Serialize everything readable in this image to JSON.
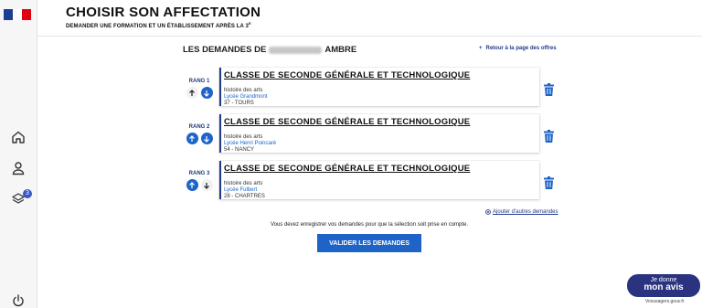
{
  "header": {
    "title": "CHOISIR SON AFFECTATION",
    "subtitle": "DEMANDER UNE FORMATION ET UN ÉTABLISSEMENT APRÈS LA 3",
    "subtitle_sup": "E"
  },
  "sidebar": {
    "items": [
      {
        "icon": "home-icon"
      },
      {
        "icon": "user-icon"
      },
      {
        "icon": "layers-icon",
        "badge": "3"
      },
      {
        "icon": "power-icon"
      }
    ]
  },
  "requests": {
    "heading_prefix": "LES DEMANDES DE",
    "heading_name": "AMBRE",
    "back_link": "Retour à la page des offres",
    "add_link": "Ajouter d'autres demandes",
    "items": [
      {
        "rank": "RANG 1",
        "title": "CLASSE DE SECONDE GÉNÉRALE ET TECHNOLOGIQUE",
        "option": "histoire des arts",
        "school": "Lycée Grandmont",
        "city": "37 - TOURS"
      },
      {
        "rank": "RANG 2",
        "title": "CLASSE DE SECONDE GÉNÉRALE ET TECHNOLOGIQUE",
        "option": "histoire des arts",
        "school": "Lycée Henri Poincaré",
        "city": "54 - NANCY"
      },
      {
        "rank": "RANG 3",
        "title": "CLASSE DE SECONDE GÉNÉRALE ET TECHNOLOGIQUE",
        "option": "histoire des arts",
        "school": "Lycée Fulbert",
        "city": "28 - CHARTRES"
      }
    ],
    "warning": "Vous devez enregistrer vos demandes pour que la sélection soit prise en compte.",
    "validate_label": "VALIDER LES DEMANDES"
  },
  "feedback": {
    "line1": "Je donne",
    "line2": "mon avis",
    "sub": "Voxusagers.gouv.fr"
  },
  "colors": {
    "accent": "#1e64c8",
    "navy": "#1f3a8a"
  }
}
